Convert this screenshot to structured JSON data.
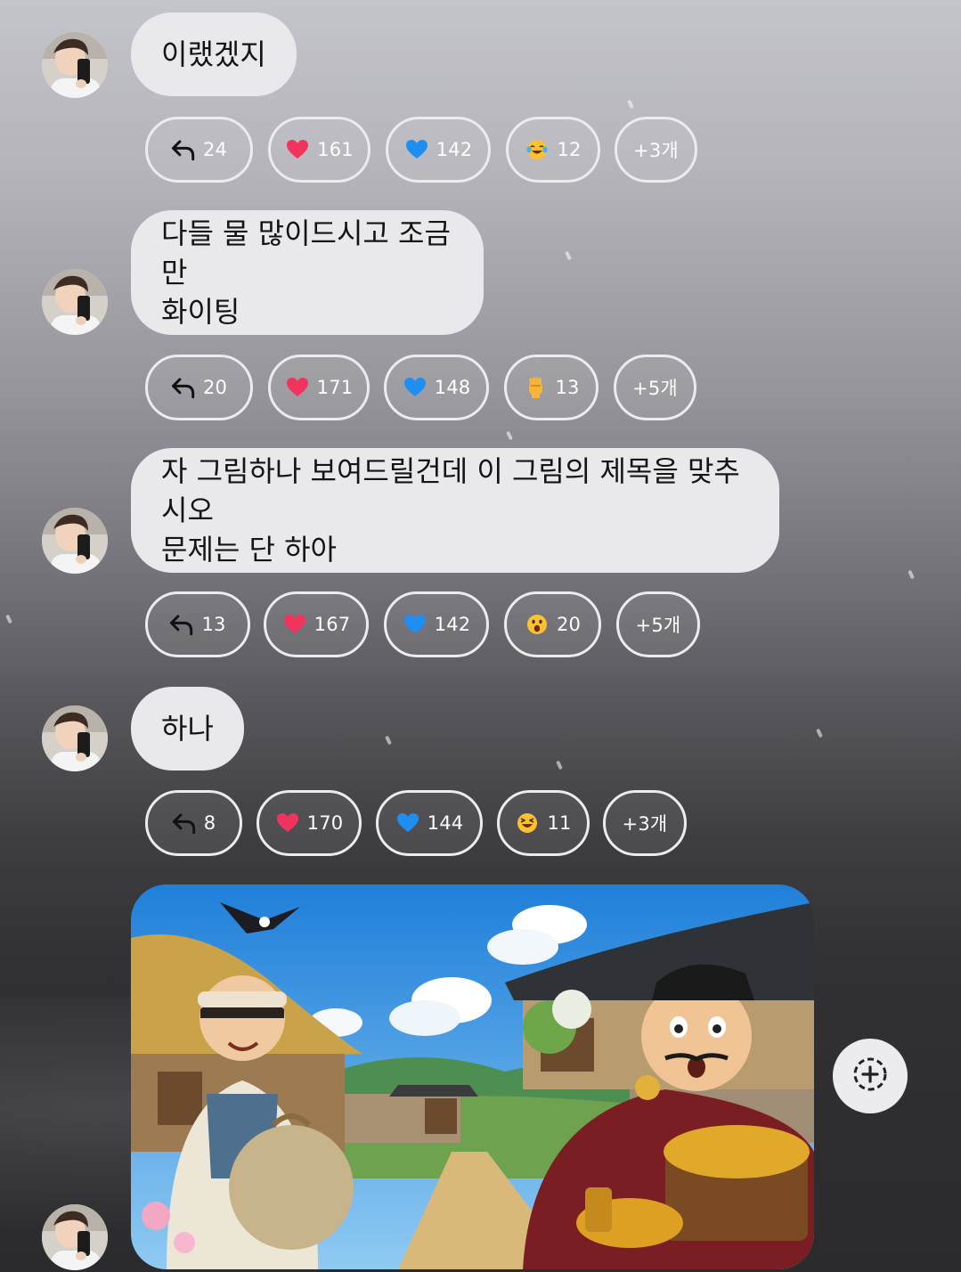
{
  "messages": [
    {
      "text": "이랬겠지",
      "reactions": {
        "reply": "24",
        "heart": "161",
        "blue_heart": "142",
        "emoji": "12",
        "emoji_icon": "tears-of-joy-emoji-icon",
        "more": "+3개"
      }
    },
    {
      "text": "다들 물 많이드시고 조금만\n화이팅",
      "reactions": {
        "reply": "20",
        "heart": "171",
        "blue_heart": "148",
        "emoji": "13",
        "emoji_icon": "raised-fist-emoji-icon",
        "more": "+5개"
      }
    },
    {
      "text": "자 그림하나 보여드릴건데 이 그림의 제목을 맞추시오\n문제는 단 하아",
      "reactions": {
        "reply": "13",
        "heart": "167",
        "blue_heart": "142",
        "emoji": "20",
        "emoji_icon": "surprised-face-emoji-icon",
        "more": "+5개"
      }
    },
    {
      "text": "하나",
      "reactions": {
        "reply": "8",
        "heart": "170",
        "blue_heart": "144",
        "emoji": "11",
        "emoji_icon": "laughing-face-emoji-icon",
        "more": "+3개"
      }
    }
  ],
  "image_message": {
    "description_icon": "illustration-image",
    "colors": {
      "sky": "#2d8fe0",
      "thatch": "#c9a24a",
      "robe": "#7a1e24"
    }
  },
  "add_reaction_button": {
    "icon": "add-reaction-icon"
  },
  "colors": {
    "bubble": "#e9e9ec",
    "chip_border": "#ececef",
    "heart": "#f0345e",
    "blue_heart": "#1f8ef1"
  }
}
